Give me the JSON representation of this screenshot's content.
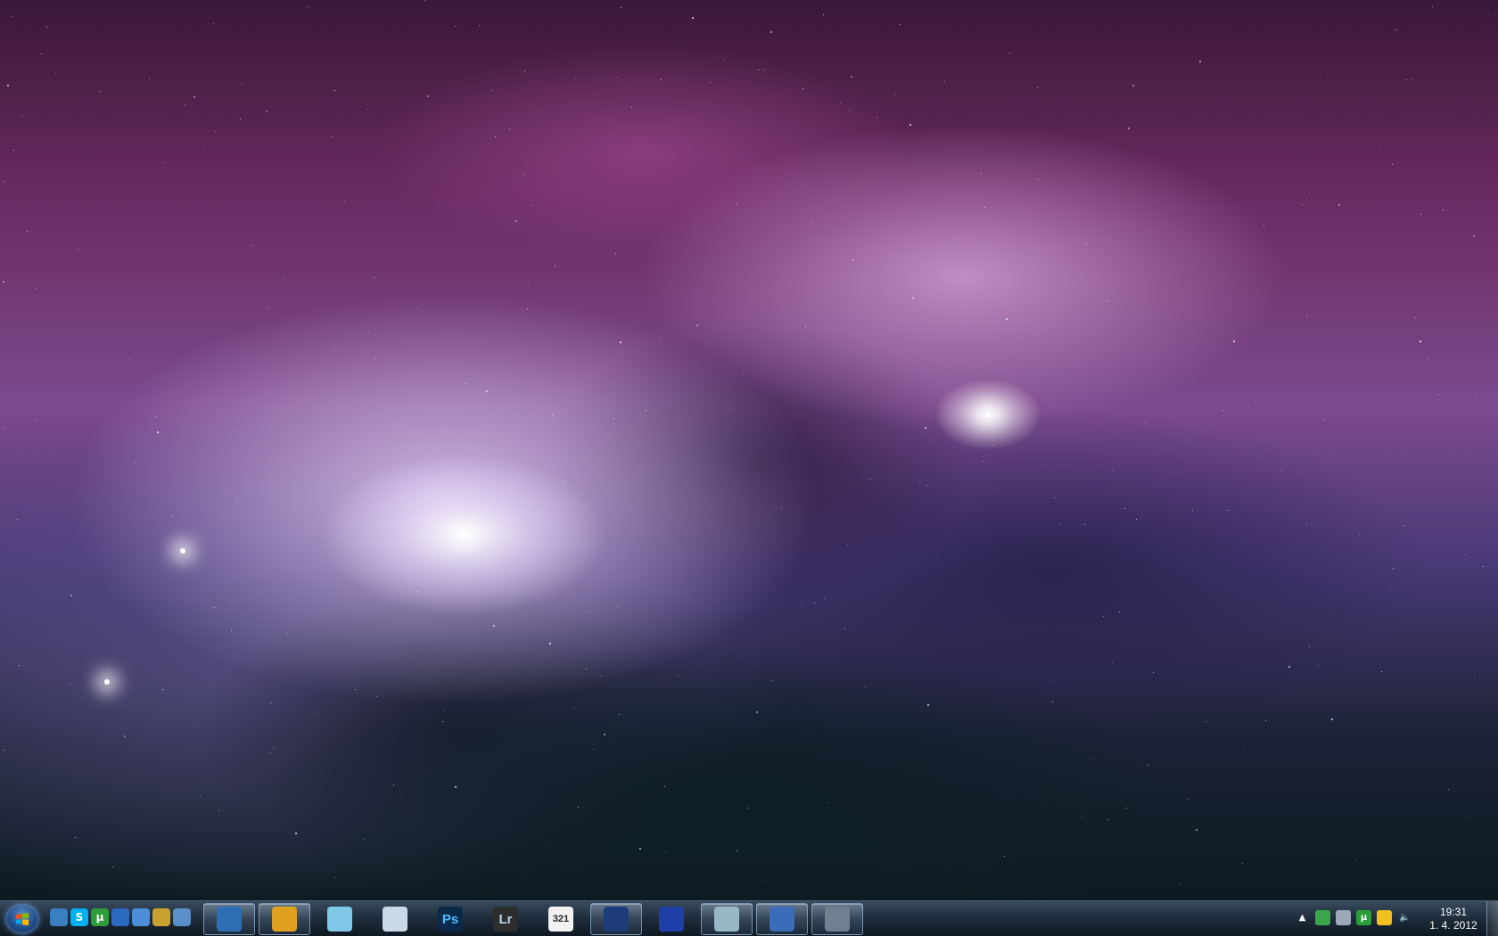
{
  "wallpaper": {
    "name": "nebula-wallpaper"
  },
  "taskbar": {
    "start_button": {
      "icon": "windows-flag-icon"
    },
    "quick_launch": [
      {
        "name": "phone-icon",
        "color": "#3a7fc2"
      },
      {
        "name": "skype-icon",
        "color": "#00aff0",
        "glyph": "S"
      },
      {
        "name": "utorrent-icon",
        "color": "#2e9e3a",
        "glyph": "µ"
      },
      {
        "name": "network-icon",
        "color": "#2c6ac0"
      },
      {
        "name": "network-connections-icon",
        "color": "#4c8fd8"
      },
      {
        "name": "file-transfer-icon",
        "color": "#c8a030"
      },
      {
        "name": "remote-desktop-icon",
        "color": "#5a8fc8"
      }
    ],
    "pinned_apps": [
      {
        "name": "thunderbird-icon",
        "running": true,
        "color": "#2f6db5"
      },
      {
        "name": "winamp-icon",
        "running": true,
        "color": "#e0a020"
      },
      {
        "name": "notepad-icon",
        "running": false,
        "color": "#7ec7e6"
      },
      {
        "name": "calculator-icon",
        "running": false,
        "color": "#c9d9e8"
      },
      {
        "name": "photoshop-icon",
        "running": false,
        "color": "#0b2a4a",
        "glyph": "Ps"
      },
      {
        "name": "lightroom-icon",
        "running": false,
        "color": "#2d2d2d",
        "glyph": "Lr"
      },
      {
        "name": "video-editor-icon",
        "running": false,
        "color": "#f2f2f2",
        "glyph": "321"
      },
      {
        "name": "globe-icon",
        "running": true,
        "color": "#1f3c7a"
      },
      {
        "name": "floppy-disk-icon",
        "running": false,
        "color": "#1f3fa8"
      },
      {
        "name": "link-icon",
        "running": true,
        "color": "#98b8c8"
      },
      {
        "name": "network-computers-icon",
        "running": true,
        "color": "#3b6cb8"
      },
      {
        "name": "lock-computer-icon",
        "running": true,
        "color": "#708090"
      }
    ]
  },
  "tray": {
    "icons": [
      {
        "name": "show-hidden-icons-icon",
        "glyph": "▲"
      },
      {
        "name": "network-status-icon",
        "color": "#3aa84a"
      },
      {
        "name": "battery-icon",
        "color": "#9aa8b8"
      },
      {
        "name": "utorrent-tray-icon",
        "color": "#2e9e3a",
        "glyph": "µ"
      },
      {
        "name": "messenger-icon",
        "color": "#f0c020"
      },
      {
        "name": "volume-icon",
        "glyph": "🔈"
      }
    ],
    "time": "19:31",
    "date": "1. 4. 2012"
  }
}
